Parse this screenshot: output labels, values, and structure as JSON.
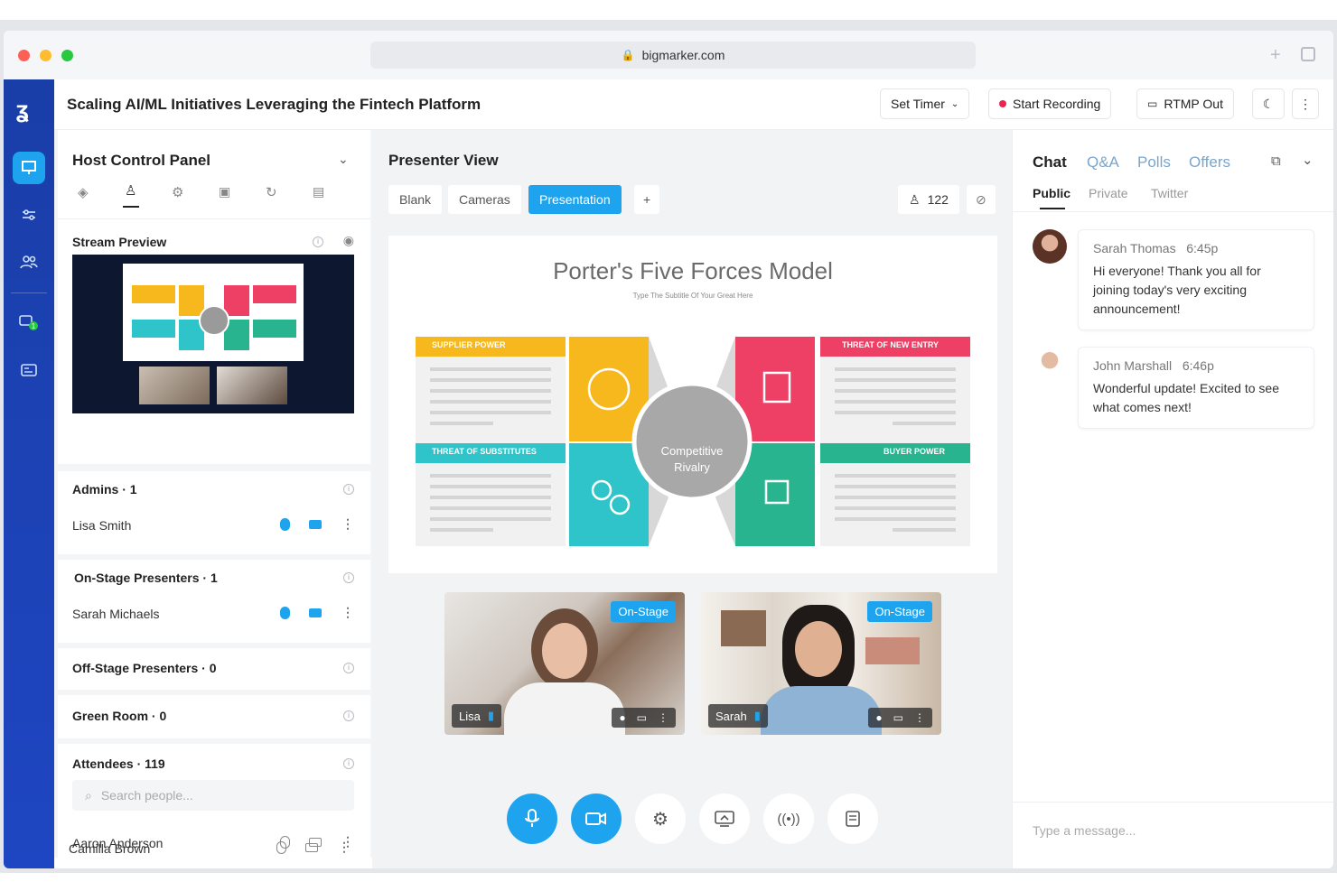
{
  "browser": {
    "url": "bigmarker.com"
  },
  "header": {
    "title": "Scaling AI/ML Initiatives Leveraging the Fintech Platform",
    "set_timer": "Set Timer",
    "start_recording": "Start Recording",
    "rtmp_out": "RTMP Out"
  },
  "host_panel": {
    "title": "Host Control Panel",
    "stream_preview": "Stream Preview",
    "admins": {
      "header": "Admins · 1",
      "people": [
        "Lisa Smith"
      ]
    },
    "onstage": {
      "header": "On-Stage Presenters · 1",
      "people": [
        "Sarah Michaels"
      ]
    },
    "offstage": {
      "header": "Off-Stage Presenters · 0"
    },
    "greenroom": {
      "header": "Green Room · 0"
    },
    "attendees": {
      "header": "Attendees · 119",
      "search_placeholder": "Search people...",
      "people": [
        "Aaron Anderson",
        "Camilla Brown"
      ]
    }
  },
  "presenter": {
    "title": "Presenter View",
    "tabs": [
      "Blank",
      "Cameras",
      "Presentation"
    ],
    "add": "+",
    "viewer_count": "122",
    "slide": {
      "title": "Porter's Five Forces Model",
      "subtitle": "Type The Subtitle Of Your Great Here",
      "center_label": "Competitive Rivalry",
      "boxes": {
        "supplier": "SUPPLIER POWER",
        "new_entry": "THREAT OF NEW ENTRY",
        "substitutes": "THREAT OF SUBSTITUTES",
        "buyer": "BUYER POWER"
      }
    },
    "tiles": [
      {
        "badge": "On-Stage",
        "name": "Lisa"
      },
      {
        "badge": "On-Stage",
        "name": "Sarah"
      }
    ]
  },
  "chat": {
    "tabs": [
      "Chat",
      "Q&A",
      "Polls",
      "Offers"
    ],
    "subtabs": [
      "Public",
      "Private",
      "Twitter"
    ],
    "messages": [
      {
        "name": "Sarah Thomas",
        "time": "6:45p",
        "text": "Hi everyone! Thank you all for joining today's very exciting announcement!"
      },
      {
        "name": "John Marshall",
        "time": "6:46p",
        "text": "Wonderful update! Excited to see what comes next!"
      }
    ],
    "input_placeholder": "Type a message..."
  },
  "colors": {
    "accent": "#1ea4ef",
    "rail": "#1e46c2",
    "record_dot": "#e8264f",
    "yellow": "#f6b81c",
    "pink": "#ee3f64",
    "teal": "#2ec4c9",
    "green": "#27b48f"
  }
}
